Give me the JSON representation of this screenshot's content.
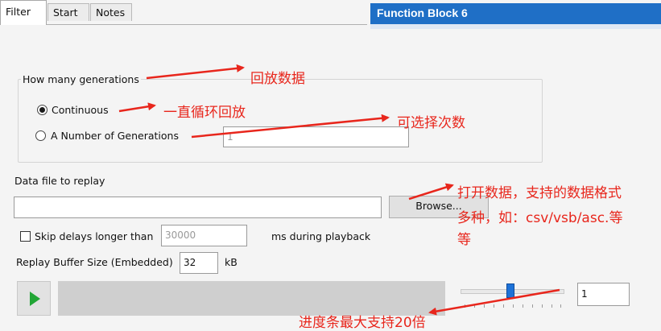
{
  "tabs": [
    {
      "label": "Filter",
      "active": true
    },
    {
      "label": "Start",
      "active": false
    },
    {
      "label": "Notes",
      "active": false
    }
  ],
  "header": {
    "title": "Function Block 6",
    "color": "#1f6fc6"
  },
  "generations": {
    "group_label": "How many generations",
    "continuous_label": "Continuous",
    "number_label": "A Number of Generations",
    "number_value": "1",
    "selected": "continuous"
  },
  "data_file": {
    "label": "Data file to replay",
    "value": "",
    "browse_label": "Browse..."
  },
  "skip": {
    "checkbox_label": "Skip delays longer than",
    "value": "30000",
    "suffix": "ms during playback",
    "checked": false
  },
  "buffer": {
    "label": "Replay Buffer Size (Embedded)",
    "value": "32",
    "unit": "kB"
  },
  "playback": {
    "play_icon": "play-icon",
    "progress": 0,
    "speed_slider_level": 0.45,
    "speed_value": "1"
  },
  "annotations": {
    "replay_data": "回放数据",
    "loop_replay": "一直循环回放",
    "selectable_count": "可选择次数",
    "open_data_line1": "打开数据，支持的数据格式",
    "open_data_line2": "多种，如：csv/vsb/asc.等",
    "open_data_line3": "等",
    "progress_note": "进度条最大支持20倍",
    "color": "#e8261c"
  }
}
